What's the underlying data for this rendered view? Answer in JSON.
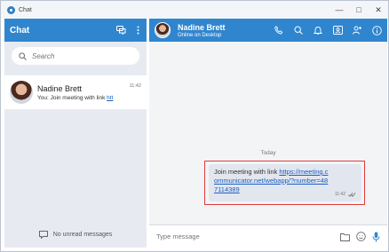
{
  "window": {
    "title": "Chat"
  },
  "sidebar": {
    "title": "Chat",
    "search": {
      "placeholder": "Search",
      "value": ""
    },
    "conversations": [
      {
        "name": "Nadine Brett",
        "preview_prefix": "You: Join meeting with link ",
        "preview_link": "htt",
        "time": "11:42"
      }
    ],
    "footer": "No unread messages"
  },
  "conversation": {
    "contact_name": "Nadine Brett",
    "contact_status": "Online on Desktop",
    "day_separator": "Today",
    "messages": [
      {
        "text": "Join meeting with link ",
        "link": "https://meeting.communicator.net/webapp/?number=487114389",
        "time": "11:42",
        "status_icon": "double-check-icon"
      }
    ],
    "composer_placeholder": "Type message"
  },
  "colors": {
    "header": "#2f86cf",
    "highlight": "#e03c3c",
    "link": "#1a5fc2"
  }
}
